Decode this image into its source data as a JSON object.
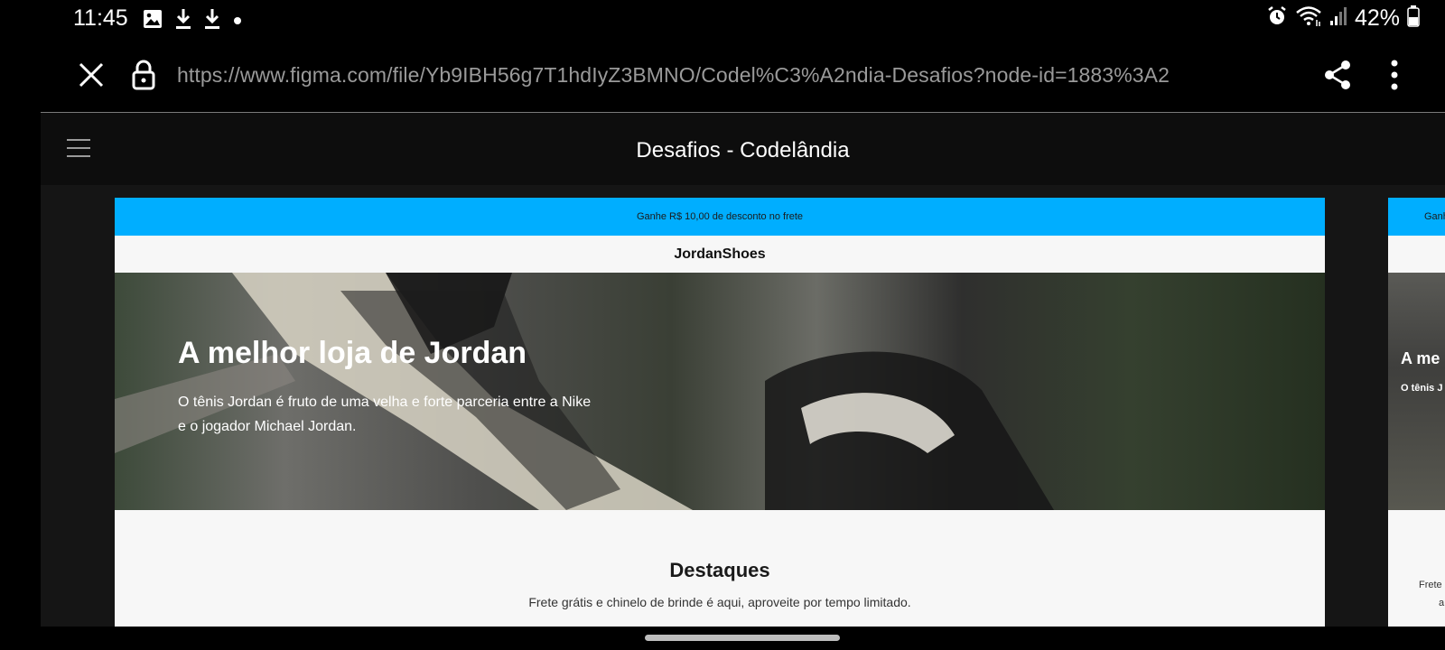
{
  "status_bar": {
    "time": "11:45",
    "left_icons": [
      "image-icon",
      "download-icon",
      "download-icon",
      "dot-icon"
    ],
    "right_icons": [
      "alarm-icon",
      "wifi-icon",
      "signal-icon",
      "battery-icon"
    ],
    "battery": "42%"
  },
  "browser": {
    "url": "https://www.figma.com/file/Yb9IBH56g7T1hdIyZ3BMNO/Codel%C3%A2ndia-Desafios?node-id=1883%3A2",
    "icons": [
      "close-icon",
      "lock-icon",
      "share-icon",
      "more-vert-icon"
    ]
  },
  "figma": {
    "title": "Desafios - Codelândia",
    "menu_icon": "hamburger-icon"
  },
  "frame": {
    "promo": "Ganhe R$ 10,00 de desconto no frete",
    "brand": "JordanShoes",
    "hero_title": "A melhor loja de Jordan",
    "hero_desc": "O tênis Jordan é fruto de uma velha e forte parceria entre a Nike e o jogador Michael Jordan.",
    "section_title": "Destaques",
    "section_sub": "Frete grátis e chinelo de brinde é aqui, aproveite por tempo limitado."
  },
  "frame2": {
    "promo": "Ganhe",
    "hero_title": "A me",
    "hero_desc": "O tênis J parceria Jordan.",
    "sub1": "Frete",
    "sub2": "a"
  },
  "colors": {
    "promo_bar": "#00aeff",
    "frame_bg": "#f7f7f7",
    "viewer_bg": "#0d0d0d"
  }
}
